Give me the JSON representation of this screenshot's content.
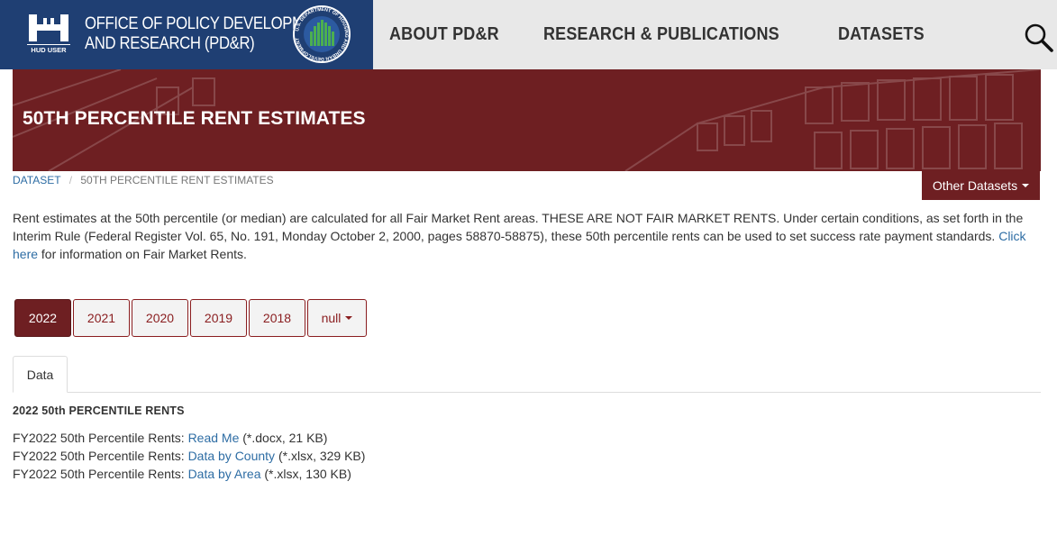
{
  "header": {
    "logo_text": "HUD USER",
    "org_title_line1": "OFFICE OF POLICY DEVELOPMENT",
    "org_title_line2": "AND RESEARCH (PD&R)",
    "seal_text": "U.S. DEPARTMENT OF HOUSING AND URBAN DEVELOPMENT",
    "nav": [
      "ABOUT PD&R",
      "RESEARCH & PUBLICATIONS",
      "DATASETS"
    ],
    "search_icon": "magnifier-icon"
  },
  "hero": {
    "title": "50TH PERCENTILE RENT ESTIMATES"
  },
  "breadcrumb": {
    "items": [
      "DATASET",
      "50TH PERCENTILE RENT ESTIMATES"
    ],
    "separator": "/"
  },
  "other_datasets": {
    "label": "Other Datasets"
  },
  "description": {
    "text": "Rent estimates at the 50th percentile (or median) are calculated for all Fair Market Rent areas. THESE ARE NOT FAIR MARKET RENTS. Under certain conditions, as set forth in the Interim Rule (Federal Register Vol. 65, No. 191, Monday October 2, 2000, pages 58870-58875), these 50th percentile rents can be used to set success rate payment standards.",
    "link": "Click here",
    "after": "for information on Fair Market Rents."
  },
  "years": {
    "items": [
      "2022",
      "2021",
      "2020",
      "2019",
      "2018"
    ],
    "active": "2022",
    "dropdown_label": "null"
  },
  "tabs": {
    "items": [
      "Data"
    ]
  },
  "section": {
    "title": "2022 50th PERCENTILE RENTS",
    "files": [
      {
        "prefix": "FY2022 50th Percentile Rents:",
        "link": "Read Me",
        "suffix": "(*.docx, 21 KB)"
      },
      {
        "prefix": "FY2022 50th Percentile Rents:",
        "link": "Data by County",
        "suffix": "(*.xlsx, 329 KB)"
      },
      {
        "prefix": "FY2022 50th Percentile Rents:",
        "link": "Data by Area",
        "suffix": "(*.xlsx, 130 KB)"
      }
    ]
  },
  "colors": {
    "brand_blue": "#1f3f73",
    "hero_maroon": "#6e1f22",
    "button_border": "#8a1d1f",
    "link_blue": "#2e6da4",
    "nav_bg": "#e8e8e8"
  }
}
